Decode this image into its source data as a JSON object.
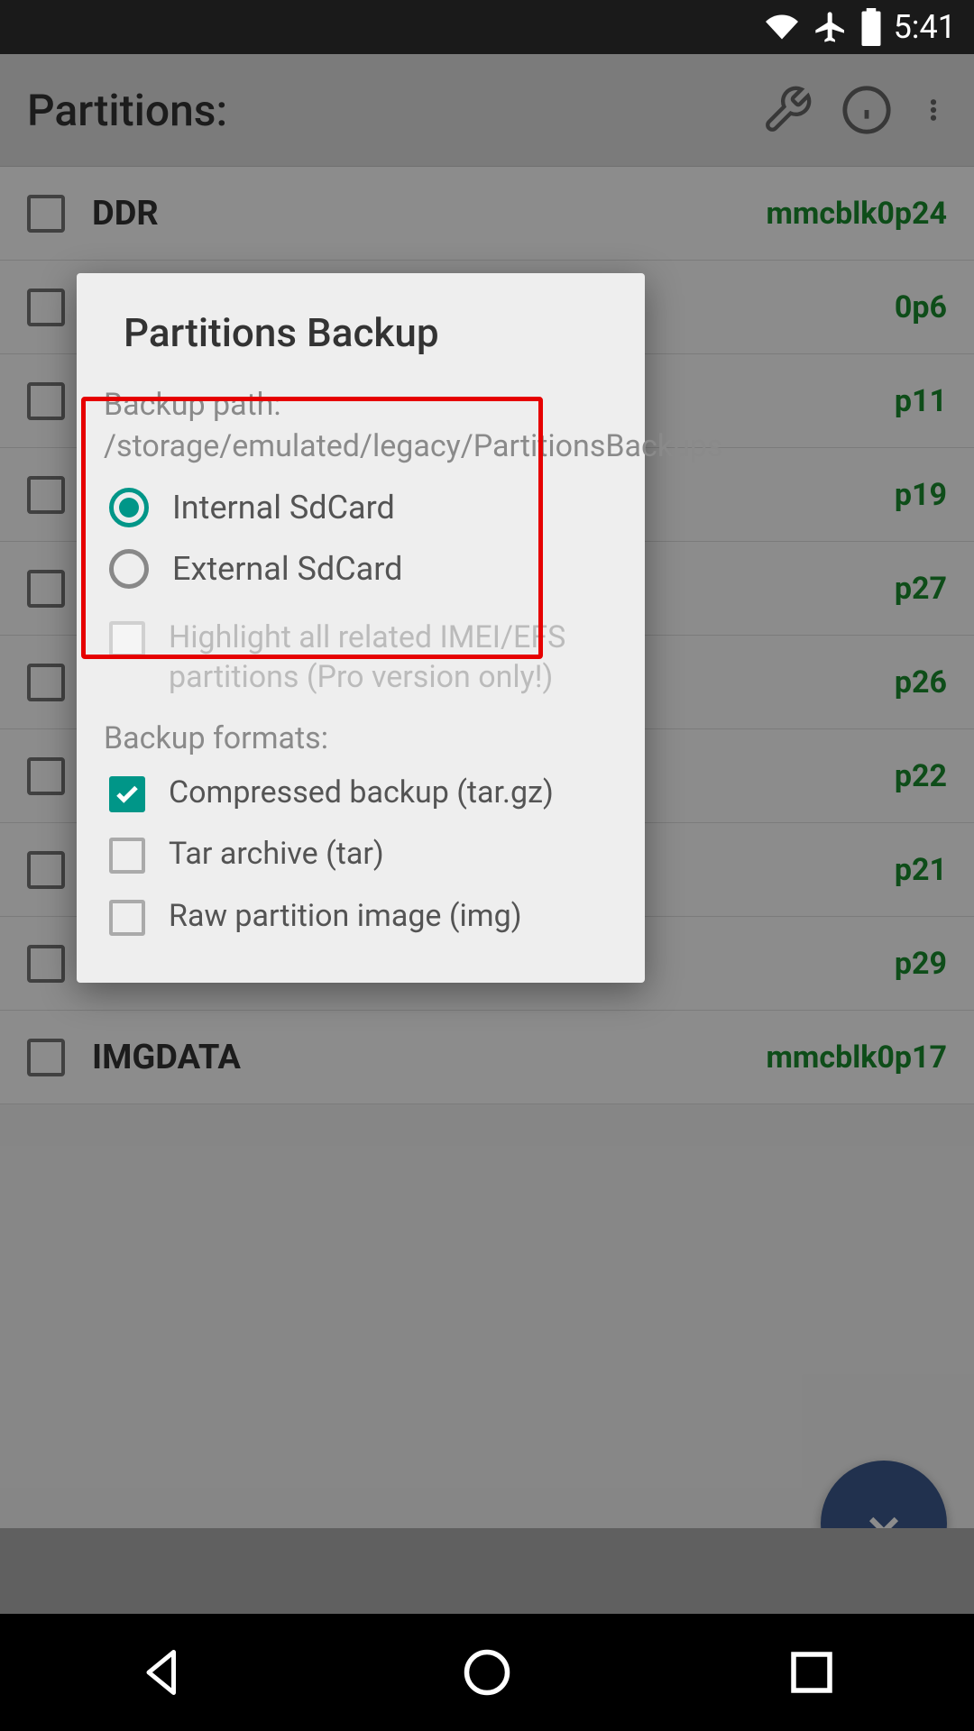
{
  "status_bar": {
    "time": "5:41"
  },
  "header": {
    "title": "Partitions:"
  },
  "partitions": [
    {
      "name": "DDR",
      "device": "mmcblk0p24"
    },
    {
      "name": "",
      "device": "0p6"
    },
    {
      "name": "",
      "device": "p11"
    },
    {
      "name": "",
      "device": "p19"
    },
    {
      "name": "",
      "device": "p27"
    },
    {
      "name": "",
      "device": "p26"
    },
    {
      "name": "",
      "device": "p22"
    },
    {
      "name": "",
      "device": "p21"
    },
    {
      "name": "",
      "device": "p29"
    },
    {
      "name": "IMGDATA",
      "device": "mmcblk0p17"
    }
  ],
  "dialog": {
    "title": "Partitions Backup",
    "backup_path_label": "Backup path:",
    "backup_path": "/storage/emulated/legacy/PartitionsBackups",
    "storage_options": {
      "internal": "Internal SdCard",
      "external": "External SdCard"
    },
    "highlight_imei": "Highlight all related IMEI/EFS partitions (Pro version only!)",
    "formats_label": "Backup formats:",
    "formats": {
      "compressed": "Compressed backup (tar.gz)",
      "tar": "Tar archive (tar)",
      "raw": "Raw partition image (img)"
    }
  }
}
